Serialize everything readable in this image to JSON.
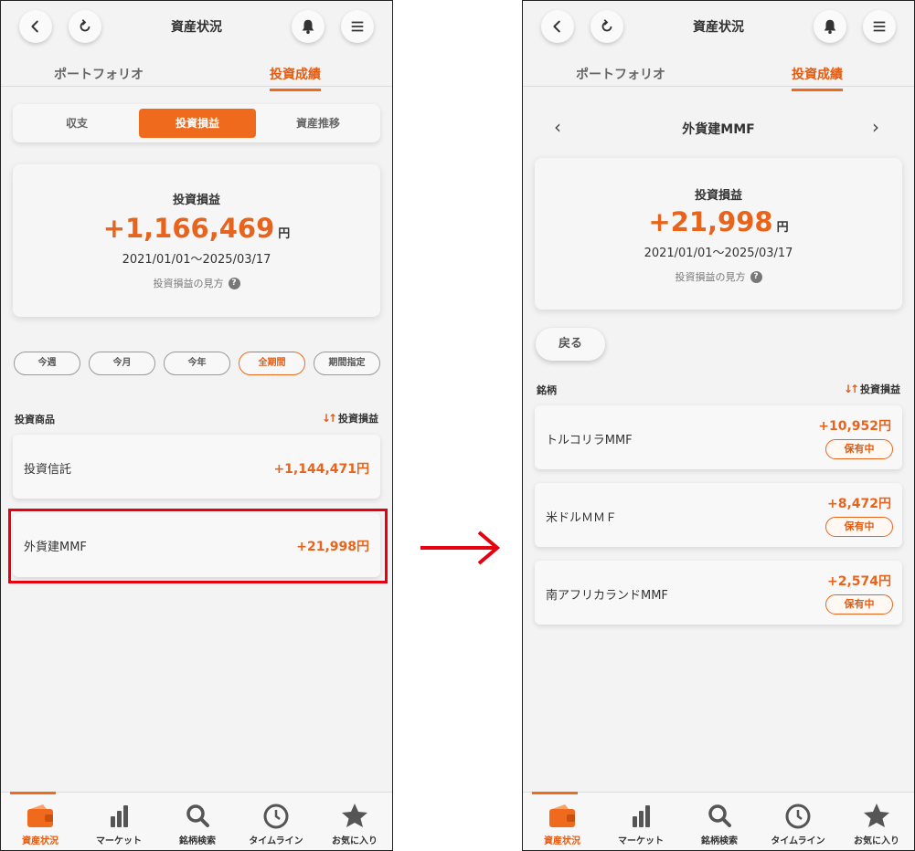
{
  "header": {
    "title": "資産状況"
  },
  "tabs": {
    "portfolio": "ポートフォリオ",
    "performance": "投資成績"
  },
  "segments": {
    "income": "収支",
    "profit": "投資損益",
    "trend": "資産推移"
  },
  "left_summary": {
    "label": "投資損益",
    "value": "+1,166,469",
    "unit": "円",
    "period": "2021/01/01〜2025/03/17",
    "help": "投資損益の見方",
    "help_mark": "?"
  },
  "periods": {
    "week": "今週",
    "month": "今月",
    "year": "今年",
    "all": "全期間",
    "custom": "期間指定"
  },
  "left_list": {
    "col_left": "投資商品",
    "col_right": "投資損益",
    "sort_glyph": "↓↑",
    "rows": [
      {
        "name": "投資信託",
        "value": "+1,144,471円"
      },
      {
        "name": "外貨建MMF",
        "value": "+21,998円"
      }
    ]
  },
  "right_sub": {
    "title": "外貨建MMF",
    "prev": "‹",
    "next": "›"
  },
  "right_summary": {
    "label": "投資損益",
    "value": "+21,998",
    "unit": "円",
    "period": "2021/01/01〜2025/03/17",
    "help": "投資損益の見方",
    "help_mark": "?"
  },
  "back_label": "戻る",
  "right_list": {
    "col_left": "銘柄",
    "col_right": "投資損益",
    "sort_glyph": "↓↑",
    "badge": "保有中",
    "rows": [
      {
        "name": "トルコリラMMF",
        "value": "+10,952円"
      },
      {
        "name": "米ドルＭＭＦ",
        "value": "+8,472円"
      },
      {
        "name": "南アフリカランドMMF",
        "value": "+2,574円"
      }
    ]
  },
  "nav": {
    "assets": "資産状況",
    "market": "マーケット",
    "search": "銘柄検索",
    "timeline": "タイムライン",
    "favorites": "お気に入り"
  },
  "colors": {
    "accent": "#f06a1e",
    "highlight": "#e60012"
  }
}
